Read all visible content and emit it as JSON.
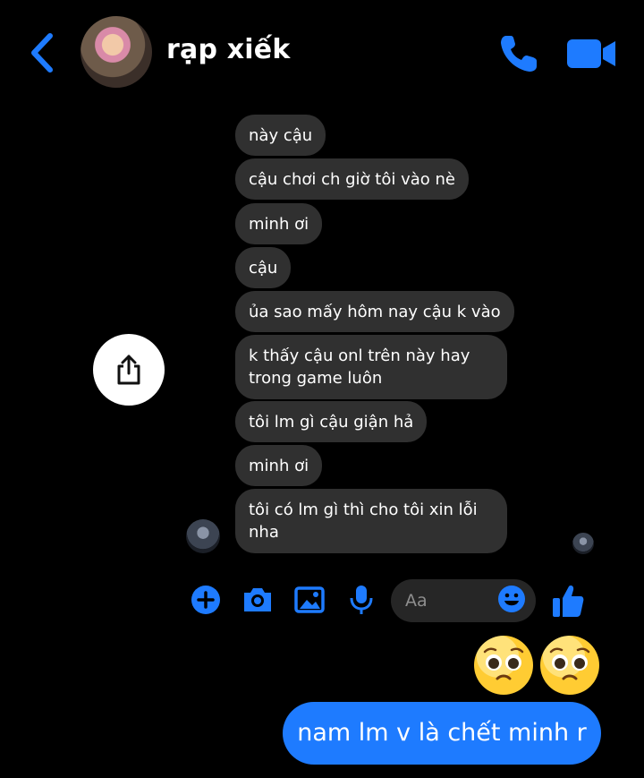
{
  "header": {
    "contact_name": "rạp xiếk",
    "back_icon": "chevron-left-icon",
    "call_icon": "phone-icon",
    "video_icon": "video-camera-icon",
    "accent_color": "#1e7bff"
  },
  "messages": [
    "này cậu",
    "cậu chơi ch giờ tôi vào nè",
    "minh ơi",
    "cậu",
    "ủa sao mấy hôm nay cậu k vào",
    "k thấy cậu onl trên này hay trong game luôn",
    "tôi lm gì cậu giận hả",
    "minh ơi",
    "tôi có lm gì thì cho tôi xin lỗi nha"
  ],
  "composer": {
    "placeholder": "Aa",
    "icons": [
      "plus-icon",
      "camera-icon",
      "image-icon",
      "microphone-icon",
      "smiley-icon",
      "thumbs-up-icon"
    ]
  },
  "reply": {
    "emojis": [
      "🥺",
      "🥺"
    ],
    "text": "nam lm v là chết minh r"
  }
}
